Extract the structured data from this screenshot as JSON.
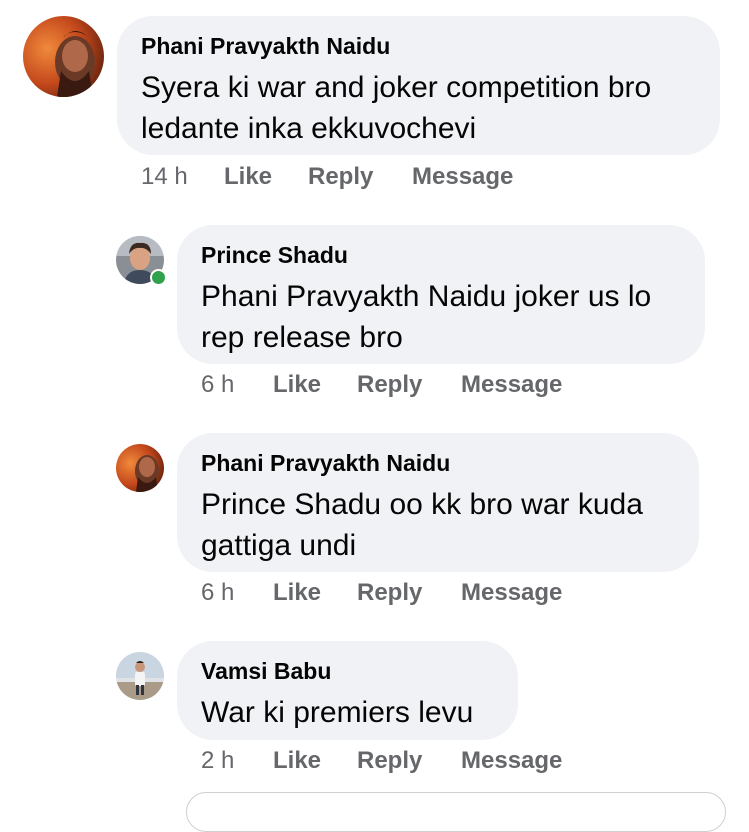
{
  "comments": [
    {
      "author": "Phani Pravyakth Naidu",
      "lines": [
        "Syera ki war and joker competition bro",
        "ledante inka ekkuvochevi"
      ],
      "time": "14 h",
      "actions": {
        "like": "Like",
        "reply": "Reply",
        "message": "Message"
      },
      "avatar": "phani-avatar",
      "online": false
    },
    {
      "author": "Prince Shadu",
      "lines": [
        "Phani Pravyakth Naidu joker us lo",
        "rep release bro"
      ],
      "time": "6 h",
      "actions": {
        "like": "Like",
        "reply": "Reply",
        "message": "Message"
      },
      "avatar": "prince-avatar",
      "online": true
    },
    {
      "author": "Phani Pravyakth Naidu",
      "lines": [
        "Prince Shadu oo kk bro war kuda",
        "gattiga undi"
      ],
      "time": "6 h",
      "actions": {
        "like": "Like",
        "reply": "Reply",
        "message": "Message"
      },
      "avatar": "phani-avatar",
      "online": false
    },
    {
      "author": "Vamsi Babu",
      "lines": [
        "War ki premiers levu"
      ],
      "time": "2 h",
      "actions": {
        "like": "Like",
        "reply": "Reply",
        "message": "Message"
      },
      "avatar": "vamsi-avatar",
      "online": false
    }
  ],
  "colors": {
    "bubble": "#f0f2f5",
    "meta_text": "#65676b",
    "online": "#31a24c"
  }
}
